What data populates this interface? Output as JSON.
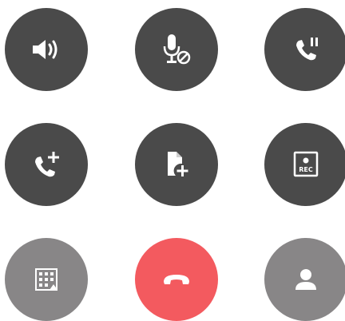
{
  "call_controls": {
    "row1": [
      "speaker-icon",
      "mute-mic-icon",
      "hold-call-icon"
    ],
    "row2": [
      "add-call-icon",
      "add-note-icon",
      "record-icon"
    ],
    "row3": [
      "keypad-icon",
      "end-call-icon",
      "contacts-icon"
    ],
    "record_label": "REC"
  },
  "colors": {
    "dark_button": "#4a4a4a",
    "grey_button": "#888687",
    "end_call": "#f35a5f",
    "icon": "#ffffff"
  }
}
